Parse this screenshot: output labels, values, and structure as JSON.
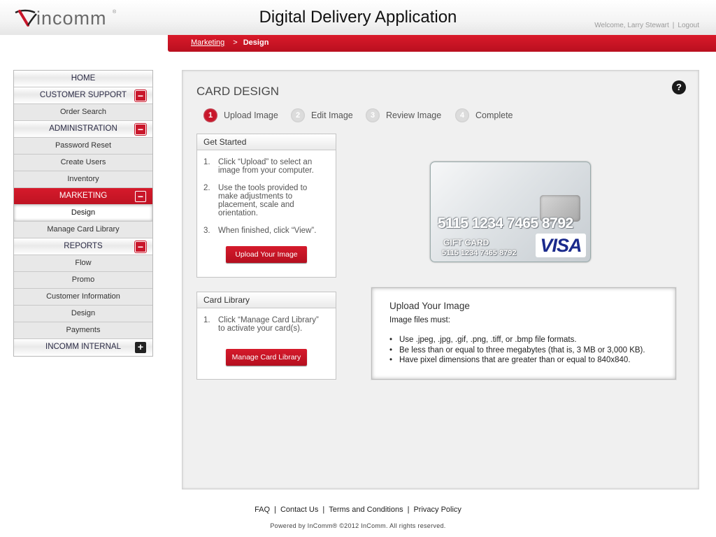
{
  "header": {
    "logo_text": "incomm",
    "logo_mark": "®",
    "title": "Digital Delivery Application",
    "welcome": "Welcome, Larry Stewart",
    "logout": "Logout"
  },
  "breadcrumb": {
    "parent": "Marketing",
    "separator": ">",
    "current": "Design"
  },
  "sidebar": {
    "items": [
      {
        "label": "HOME",
        "kind": "head",
        "toggle": ""
      },
      {
        "label": "CUSTOMER SUPPORT",
        "kind": "head",
        "toggle": "minus"
      },
      {
        "label": "Order Search",
        "kind": "item"
      },
      {
        "label": "ADMINISTRATION",
        "kind": "head",
        "toggle": "minus"
      },
      {
        "label": "Password Reset",
        "kind": "item"
      },
      {
        "label": "Create Users",
        "kind": "item"
      },
      {
        "label": "Inventory",
        "kind": "item"
      },
      {
        "label": "MARKETING",
        "kind": "active",
        "toggle": "minus"
      },
      {
        "label": "Design",
        "kind": "selected"
      },
      {
        "label": "Manage Card Library",
        "kind": "item"
      },
      {
        "label": "REPORTS",
        "kind": "head",
        "toggle": "minus"
      },
      {
        "label": "Flow",
        "kind": "item"
      },
      {
        "label": "Promo",
        "kind": "item"
      },
      {
        "label": "Customer Information",
        "kind": "item"
      },
      {
        "label": "Design",
        "kind": "item"
      },
      {
        "label": "Payments",
        "kind": "item"
      },
      {
        "label": "INCOMM INTERNAL",
        "kind": "head",
        "toggle": "plus"
      }
    ],
    "toggle_minus": "−",
    "toggle_plus": "+"
  },
  "main": {
    "title": "CARD DESIGN",
    "help": "?",
    "steps": [
      {
        "num": "1",
        "label": "Upload Image",
        "active": true
      },
      {
        "num": "2",
        "label": "Edit Image",
        "active": false
      },
      {
        "num": "3",
        "label": "Review Image",
        "active": false
      },
      {
        "num": "4",
        "label": "Complete",
        "active": false
      }
    ],
    "get_started": {
      "title": "Get Started",
      "items": [
        {
          "n": "1.",
          "text": "Click “Upload” to select an image from your computer."
        },
        {
          "n": "2.",
          "text": "Use the tools provided to make adjustments to placement, scale and orientation."
        },
        {
          "n": "3.",
          "text": "When finished, click “View”."
        }
      ],
      "button": "Upload Your Image"
    },
    "card_library": {
      "title": "Card Library",
      "items": [
        {
          "n": "1.",
          "text": "Click “Manage Card Library” to activate your card(s)."
        }
      ],
      "button": "Manage Card Library"
    },
    "card_preview": {
      "number": "5115 1234 7465 8792",
      "label": "GIFT CARD",
      "number_small": "5115 1234  7465 8792",
      "brand": "VISA"
    },
    "upload_info": {
      "title": "Upload Your Image",
      "subtitle": "Image files must:",
      "rules": [
        "Use .jpeg, .jpg, .gif, .png, .tiff, or .bmp file formats.",
        "Be less than or equal to three megabytes (that is, 3 MB or 3,000 KB).",
        "Have pixel dimensions that are greater than or equal to 840x840."
      ]
    }
  },
  "footer": {
    "links": [
      "FAQ",
      "Contact Us",
      "Terms and Conditions",
      "Privacy Policy"
    ],
    "separator": "|",
    "powered": "Powered by InComm® ©2012 InComm. All rights reserved."
  },
  "colors": {
    "brand_red": "#c8162a",
    "panel_bg": "#f0f0f0"
  }
}
